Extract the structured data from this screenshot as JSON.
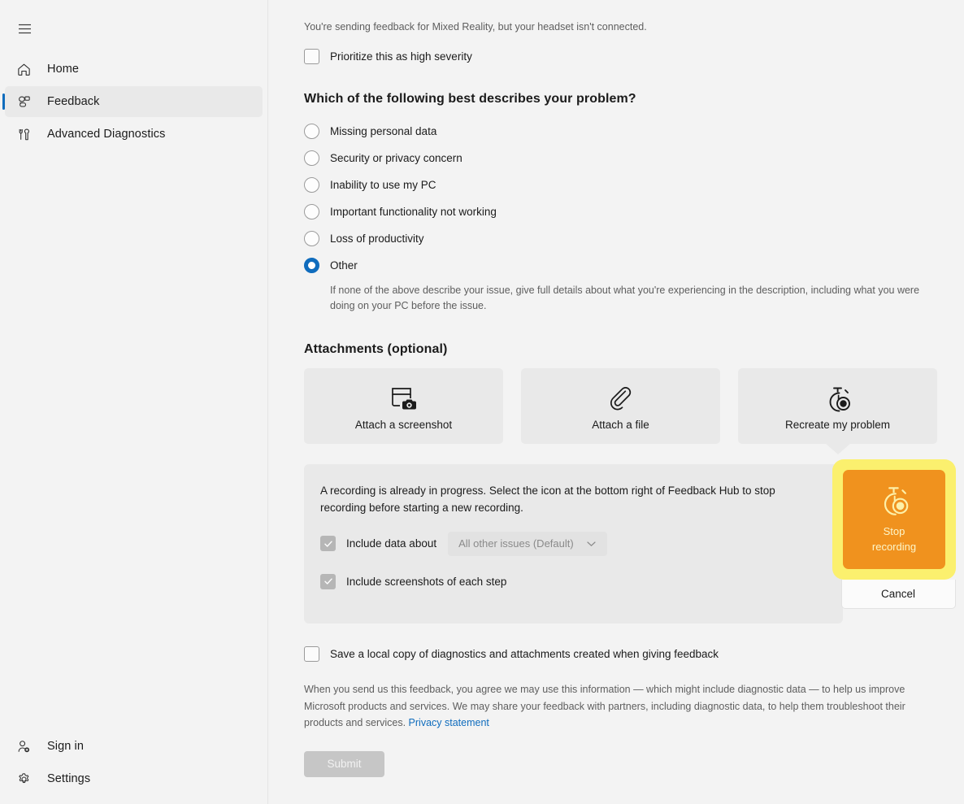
{
  "sidebar": {
    "menu_button": "hamburger-menu",
    "items": [
      {
        "label": "Home",
        "icon": "home-icon"
      },
      {
        "label": "Feedback",
        "icon": "feedback-icon"
      },
      {
        "label": "Advanced Diagnostics",
        "icon": "diagnostics-icon"
      }
    ],
    "bottom_items": [
      {
        "label": "Sign in",
        "icon": "sign-in-icon"
      },
      {
        "label": "Settings",
        "icon": "gear-icon"
      }
    ],
    "selected": "Feedback",
    "accent_color": "#0f6cbd"
  },
  "main": {
    "notice": "You're sending feedback for Mixed Reality, but your headset isn't connected.",
    "priority_checkbox": {
      "label": "Prioritize this as high severity",
      "checked": false
    },
    "problem_section": {
      "title": "Which of the following best describes your problem?",
      "options": [
        "Missing personal data",
        "Security or privacy concern",
        "Inability to use my PC",
        "Important functionality not working",
        "Loss of productivity",
        "Other"
      ],
      "selected": "Other",
      "help_text": "If none of the above describe your issue, give full details about what you're experiencing in the description, including what you were doing on your PC before the issue."
    },
    "attachments": {
      "title": "Attachments (optional)",
      "buttons": [
        {
          "label": "Attach a screenshot",
          "icon": "screenshot-camera-icon"
        },
        {
          "label": "Attach a file",
          "icon": "paperclip-icon"
        },
        {
          "label": "Recreate my problem",
          "icon": "stopwatch-record-icon"
        }
      ]
    },
    "recording_panel": {
      "message": "A recording is already in progress. Select the icon at the bottom right of Feedback Hub to stop recording before starting a new recording.",
      "include_data_label": "Include data about",
      "include_data_checked": true,
      "dropdown_value": "All other issues (Default)",
      "include_screenshots_label": "Include screenshots of each step",
      "include_screenshots_checked": true
    },
    "stop_recording": {
      "label_line1": "Stop",
      "label_line2": "recording",
      "icon": "stopwatch-record-icon",
      "button_color": "#f0921e",
      "highlight_color": "#fbf06e",
      "cancel_label": "Cancel"
    },
    "save_local_checkbox": {
      "label": "Save a local copy of diagnostics and attachments created when giving feedback",
      "checked": false
    },
    "legal_text": "When you send us this feedback, you agree we may use this information — which might include diagnostic data — to help us improve Microsoft products and services. We may share your feedback with partners, including diagnostic data, to help them troubleshoot their products and services. ",
    "privacy_link": "Privacy statement",
    "submit_label": "Submit"
  }
}
